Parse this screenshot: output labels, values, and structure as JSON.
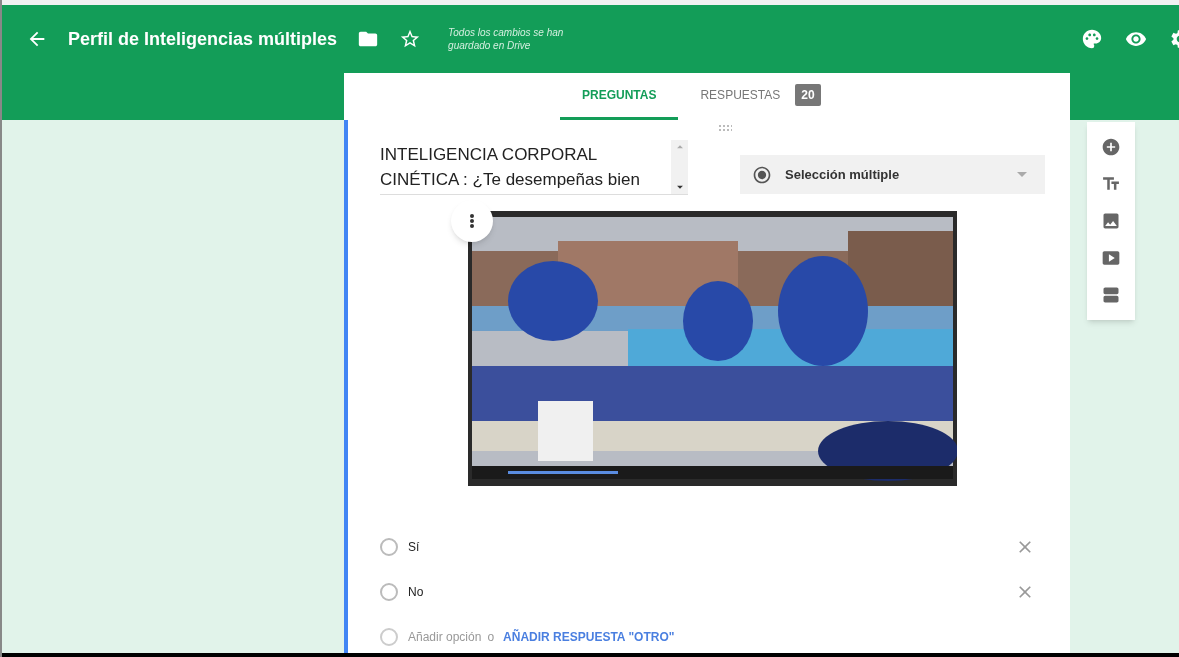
{
  "header": {
    "title": "Perfil de Inteligencias múltiples",
    "save_status": "Todos los cambios se han guardado en Drive"
  },
  "tabs": [
    {
      "label": "PREGUNTAS",
      "selected": true
    },
    {
      "label": "RESPUESTAS",
      "selected": false,
      "count": "20"
    }
  ],
  "question": {
    "title_lines": [
      "INTELIGENCIA CORPORAL",
      "CINÉTICA : ¿Te desempeñas bien"
    ],
    "type": "Selección múltiple",
    "options": [
      {
        "label": "Sí"
      },
      {
        "label": "No"
      }
    ],
    "add_option": {
      "label": "Añadir opción",
      "separator": "o",
      "other_link": "AÑADIR RESPUESTA \"OTRO\""
    }
  }
}
